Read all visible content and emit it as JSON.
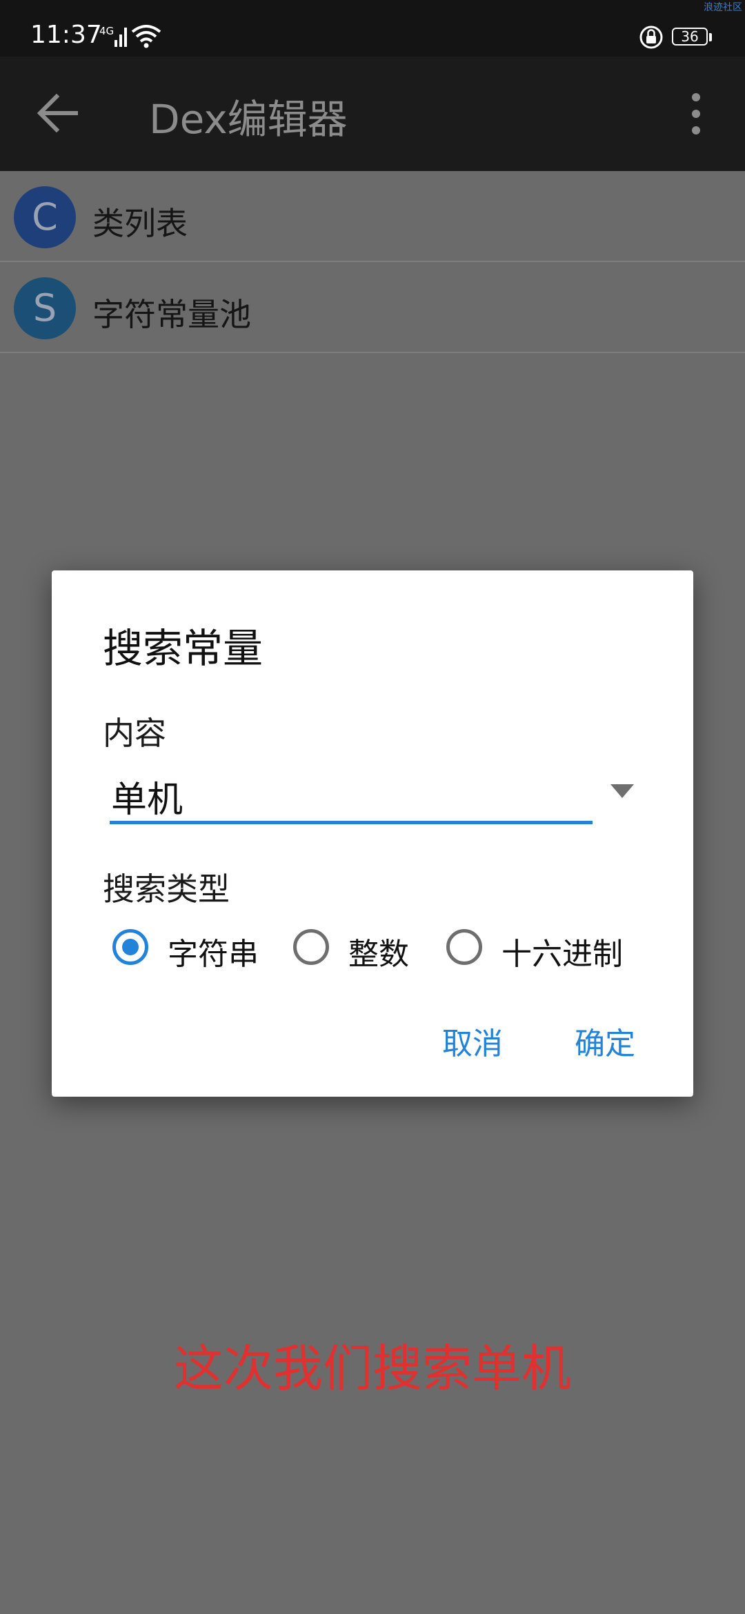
{
  "status_bar": {
    "time": "11:37",
    "network": "4G",
    "battery": "36",
    "watermark": "浪迹社区"
  },
  "app_bar": {
    "title": "Dex编辑器"
  },
  "list": {
    "items": [
      {
        "avatar": "C",
        "label": "类列表",
        "avatar_color": "#1e3f7a"
      },
      {
        "avatar": "S",
        "label": "字符常量池",
        "avatar_color": "#1b4f76"
      }
    ]
  },
  "dialog": {
    "title": "搜索常量",
    "content_label": "内容",
    "content_value": "单机",
    "type_label": "搜索类型",
    "radio_options": [
      "字符串",
      "整数",
      "十六进制"
    ],
    "selected_option": "字符串",
    "cancel_label": "取消",
    "ok_label": "确定"
  },
  "caption": "这次我们搜索单机",
  "colors": {
    "accent": "#2283d8",
    "caption": "#e03030"
  }
}
